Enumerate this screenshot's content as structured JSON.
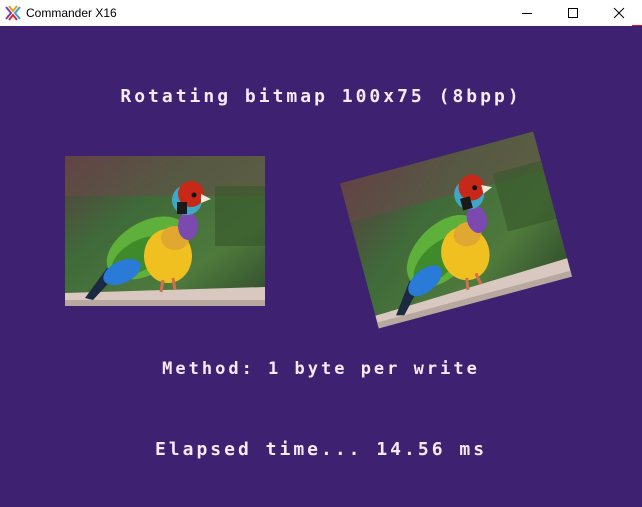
{
  "window": {
    "title": "Commander X16",
    "app_icon": "commander-x16-logo-icon",
    "controls": [
      "minimize-icon",
      "maximize-icon",
      "close-icon"
    ]
  },
  "screen": {
    "background": "#3f2171",
    "text_color": "#f6eaf8",
    "heading": "Rotating bitmap 100x75 (8bpp)",
    "method": "Method: 1 byte per write",
    "elapsed": "Elapsed time... 14.56 ms"
  },
  "bitmaps": {
    "original": "finch-bitmap-original",
    "rotated": "finch-bitmap-rotated"
  }
}
